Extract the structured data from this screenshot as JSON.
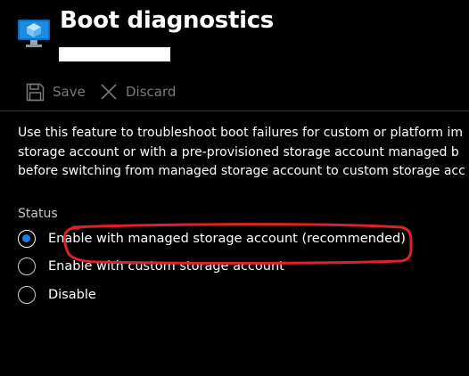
{
  "header": {
    "title": "Boot diagnostics",
    "icon": "virtual-machine-icon"
  },
  "toolbar": {
    "save_label": "Save",
    "discard_label": "Discard"
  },
  "description": {
    "lines": [
      "Use this feature to troubleshoot boot failures for custom or platform im",
      "storage account or with a pre-provisioned storage account managed b",
      "before switching from managed storage account to custom storage acc"
    ]
  },
  "status": {
    "label": "Status",
    "options": [
      {
        "label": "Enable with managed storage account (recommended)",
        "selected": true
      },
      {
        "label": "Enable with custom storage account",
        "selected": false
      },
      {
        "label": "Disable",
        "selected": false
      }
    ]
  },
  "colors": {
    "background": "#000000",
    "accent": "#1a7fe6",
    "annotation": "#e0202a"
  }
}
